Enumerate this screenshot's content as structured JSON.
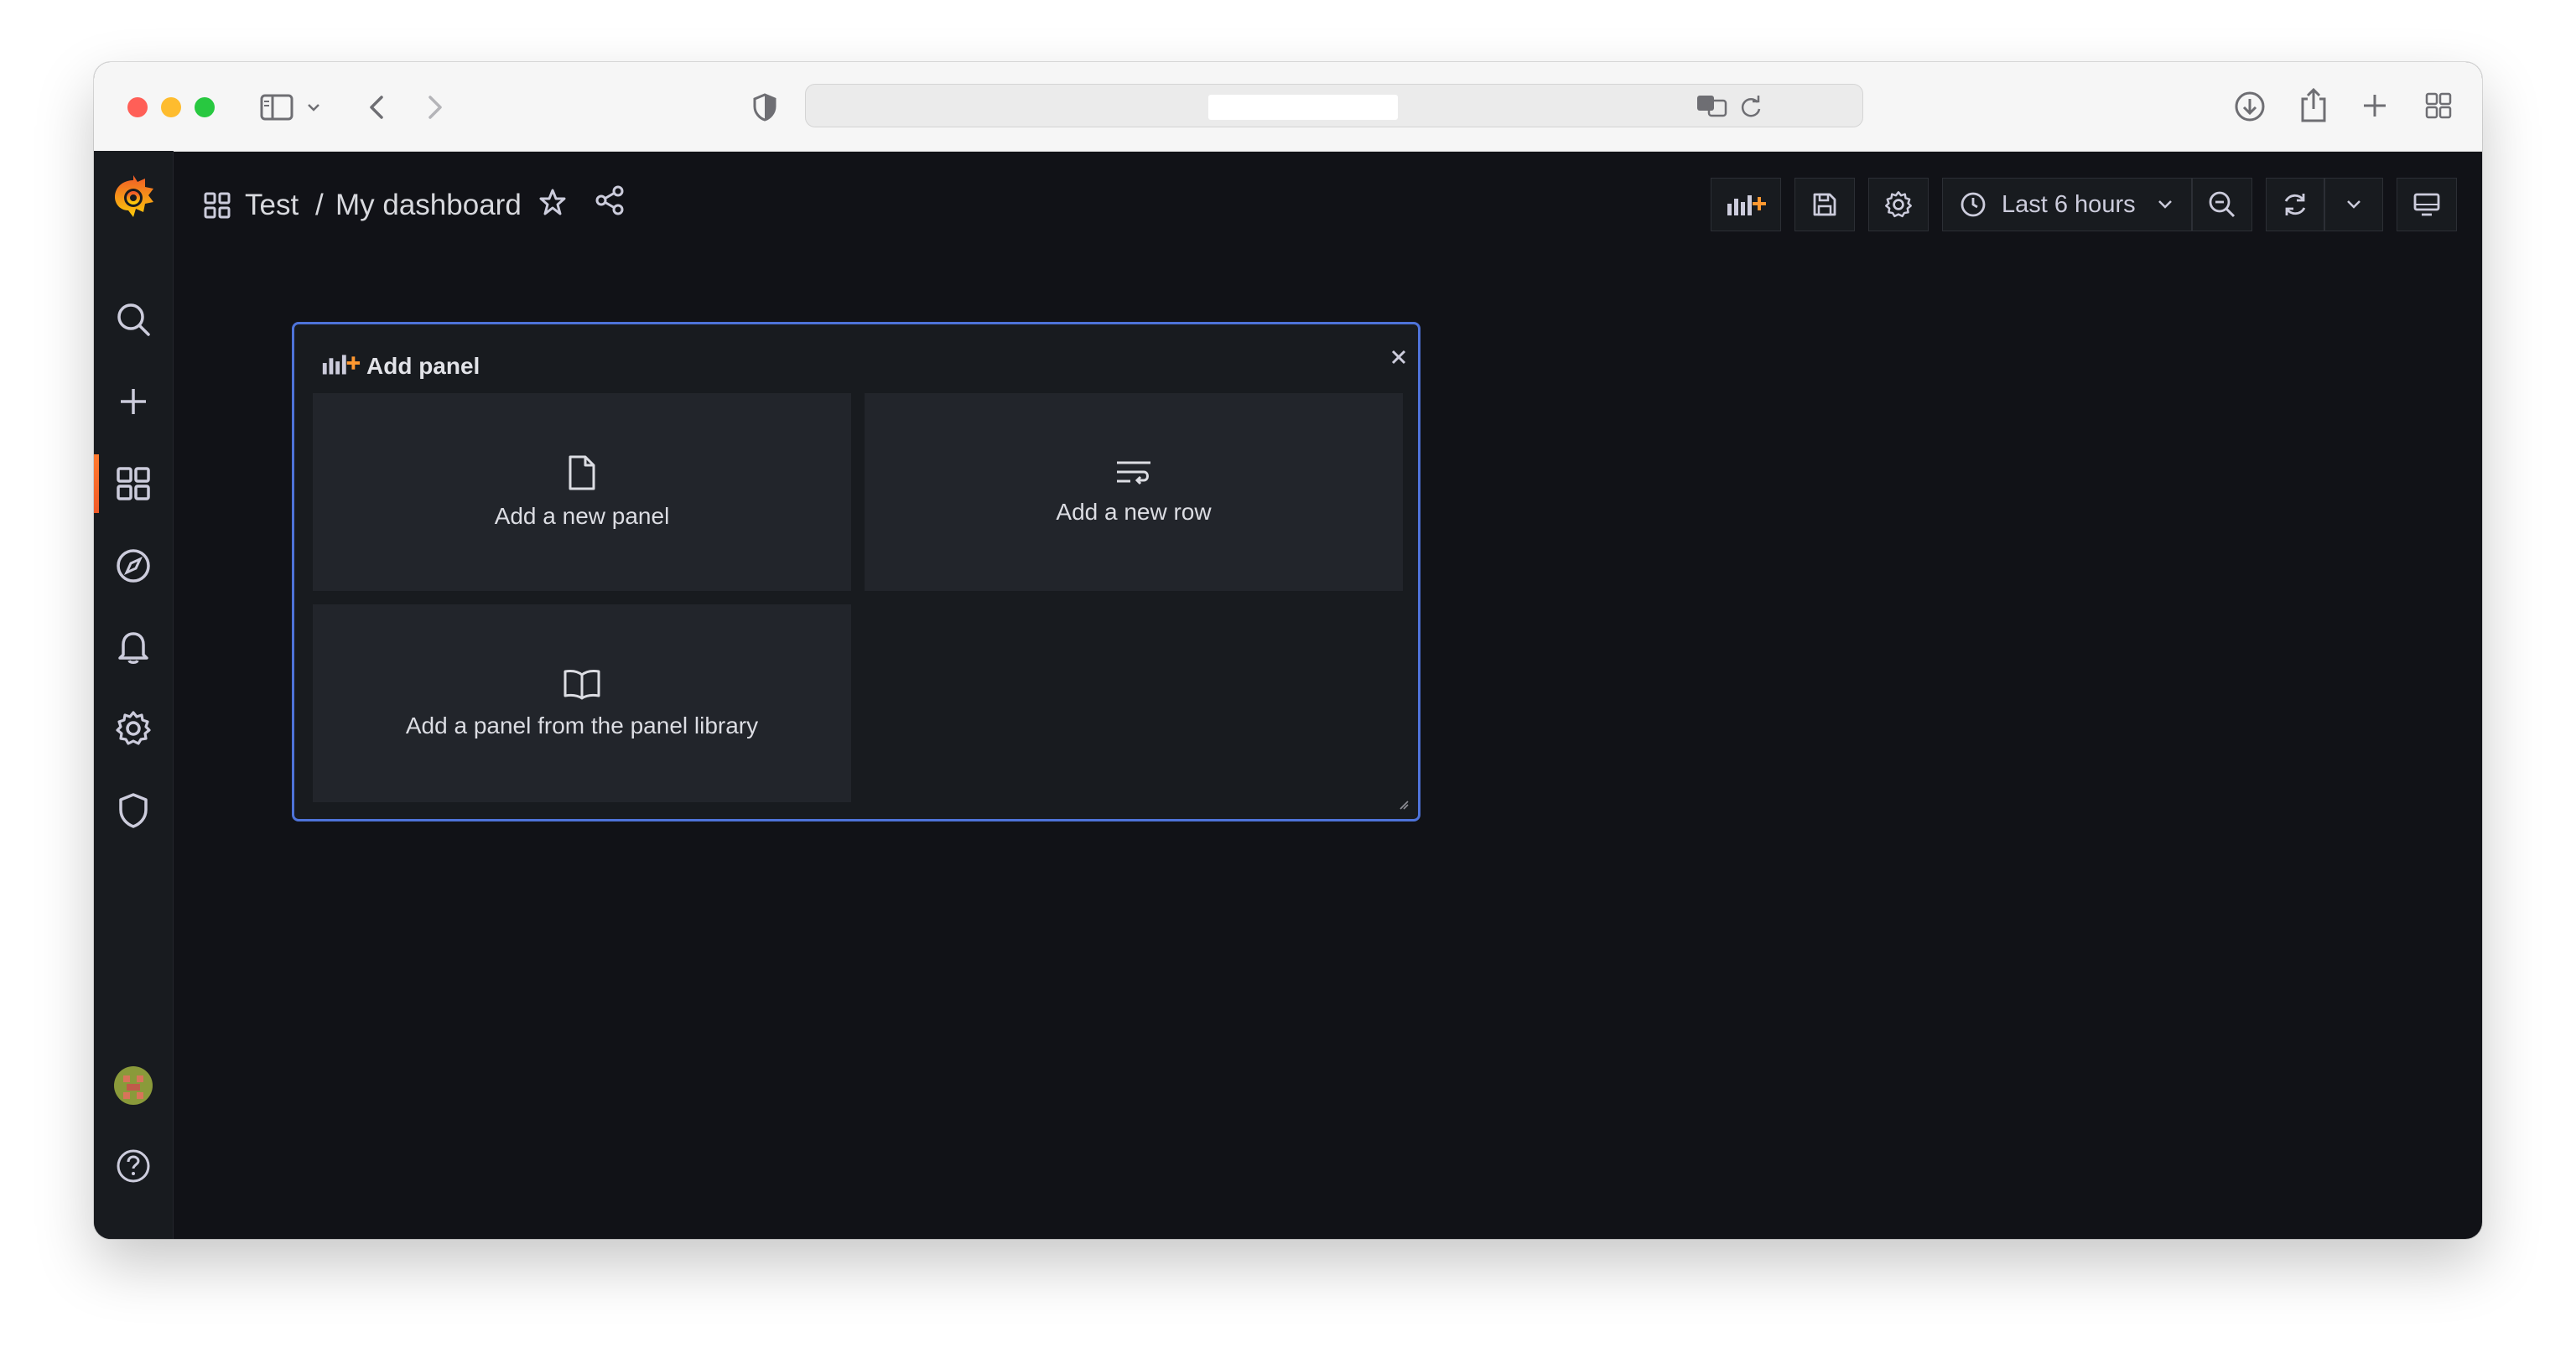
{
  "browser": {
    "traffic_lights": [
      "#ff5f57",
      "#febc2e",
      "#28c840"
    ]
  },
  "breadcrumb": {
    "folder": "Test",
    "separator": "/",
    "dashboard": "My dashboard"
  },
  "toolbar": {
    "time_range_label": "Last 6 hours"
  },
  "add_panel": {
    "title": "Add panel",
    "options": [
      {
        "label": "Add a new panel",
        "icon": "file-icon"
      },
      {
        "label": "Add a new row",
        "icon": "row-icon"
      },
      {
        "label": "Add a panel from the panel library",
        "icon": "book-icon"
      }
    ]
  },
  "sidebar": {
    "items": [
      "search-icon",
      "plus-icon",
      "dashboards-icon",
      "explore-icon",
      "alerting-icon",
      "gear-icon",
      "shield-icon"
    ],
    "active": "dashboards-icon"
  },
  "colors": {
    "accent_orange": "#f05a28",
    "panel_border": "#4e73d9",
    "background": "#111217"
  }
}
